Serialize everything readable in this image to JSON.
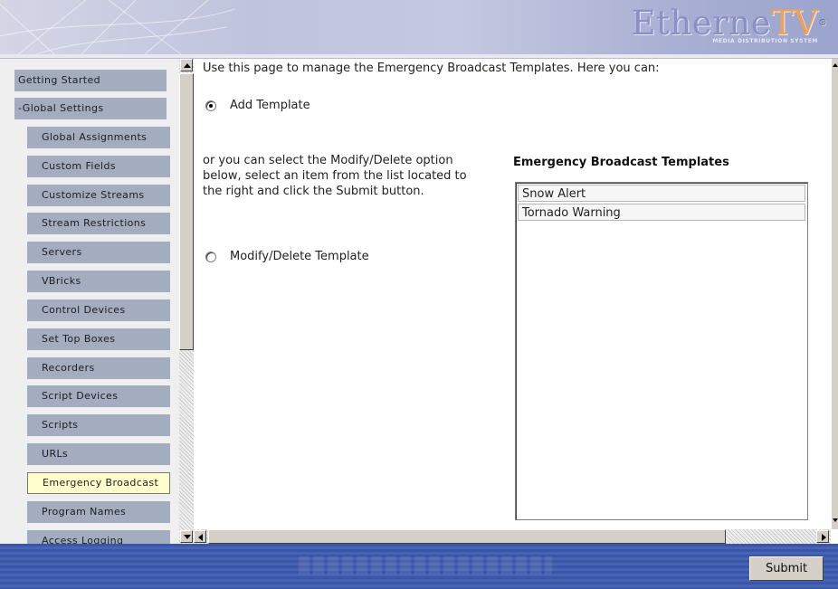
{
  "header": {
    "logo_main": "Etherne",
    "logo_accent": "TV",
    "logo_registered": "®",
    "logo_tagline": "MEDIA DISTRIBUTION SYSTEM"
  },
  "sidebar": {
    "items": [
      {
        "label": "Getting Started",
        "level": "top"
      },
      {
        "label": "-Global Settings",
        "level": "top"
      },
      {
        "label": "Global Assignments",
        "level": "sub"
      },
      {
        "label": "Custom Fields",
        "level": "sub"
      },
      {
        "label": "Customize Streams",
        "level": "sub"
      },
      {
        "label": "Stream Restrictions",
        "level": "sub"
      },
      {
        "label": "Servers",
        "level": "sub"
      },
      {
        "label": "VBricks",
        "level": "sub"
      },
      {
        "label": "Control Devices",
        "level": "sub"
      },
      {
        "label": "Set Top Boxes",
        "level": "sub"
      },
      {
        "label": "Recorders",
        "level": "sub"
      },
      {
        "label": "Script Devices",
        "level": "sub"
      },
      {
        "label": "Scripts",
        "level": "sub"
      },
      {
        "label": "URLs",
        "level": "sub"
      },
      {
        "label": "Emergency Broadcast",
        "level": "sub",
        "active": true
      },
      {
        "label": "Program Names",
        "level": "sub"
      },
      {
        "label": "Access Logging",
        "level": "sub"
      }
    ]
  },
  "main": {
    "intro": "Use this page to manage the Emergency Broadcast Templates. Here you can:",
    "add_option": "Add Template",
    "add_selected": true,
    "instructions": [
      "or you can select the Modify/Delete option",
      "below, select an item from the list located to",
      "the right and click the Submit button."
    ],
    "modify_option": "Modify/Delete Template",
    "modify_selected": false,
    "templates_title": "Emergency Broadcast Templates",
    "templates": [
      "Snow Alert",
      "Tornado Warning"
    ]
  },
  "footer": {
    "submit_label": "Submit"
  },
  "colors": {
    "nav_bg": "#a4acbf",
    "nav_active_bg": "#ffffcc",
    "footer_blue": "#3a56a8"
  }
}
